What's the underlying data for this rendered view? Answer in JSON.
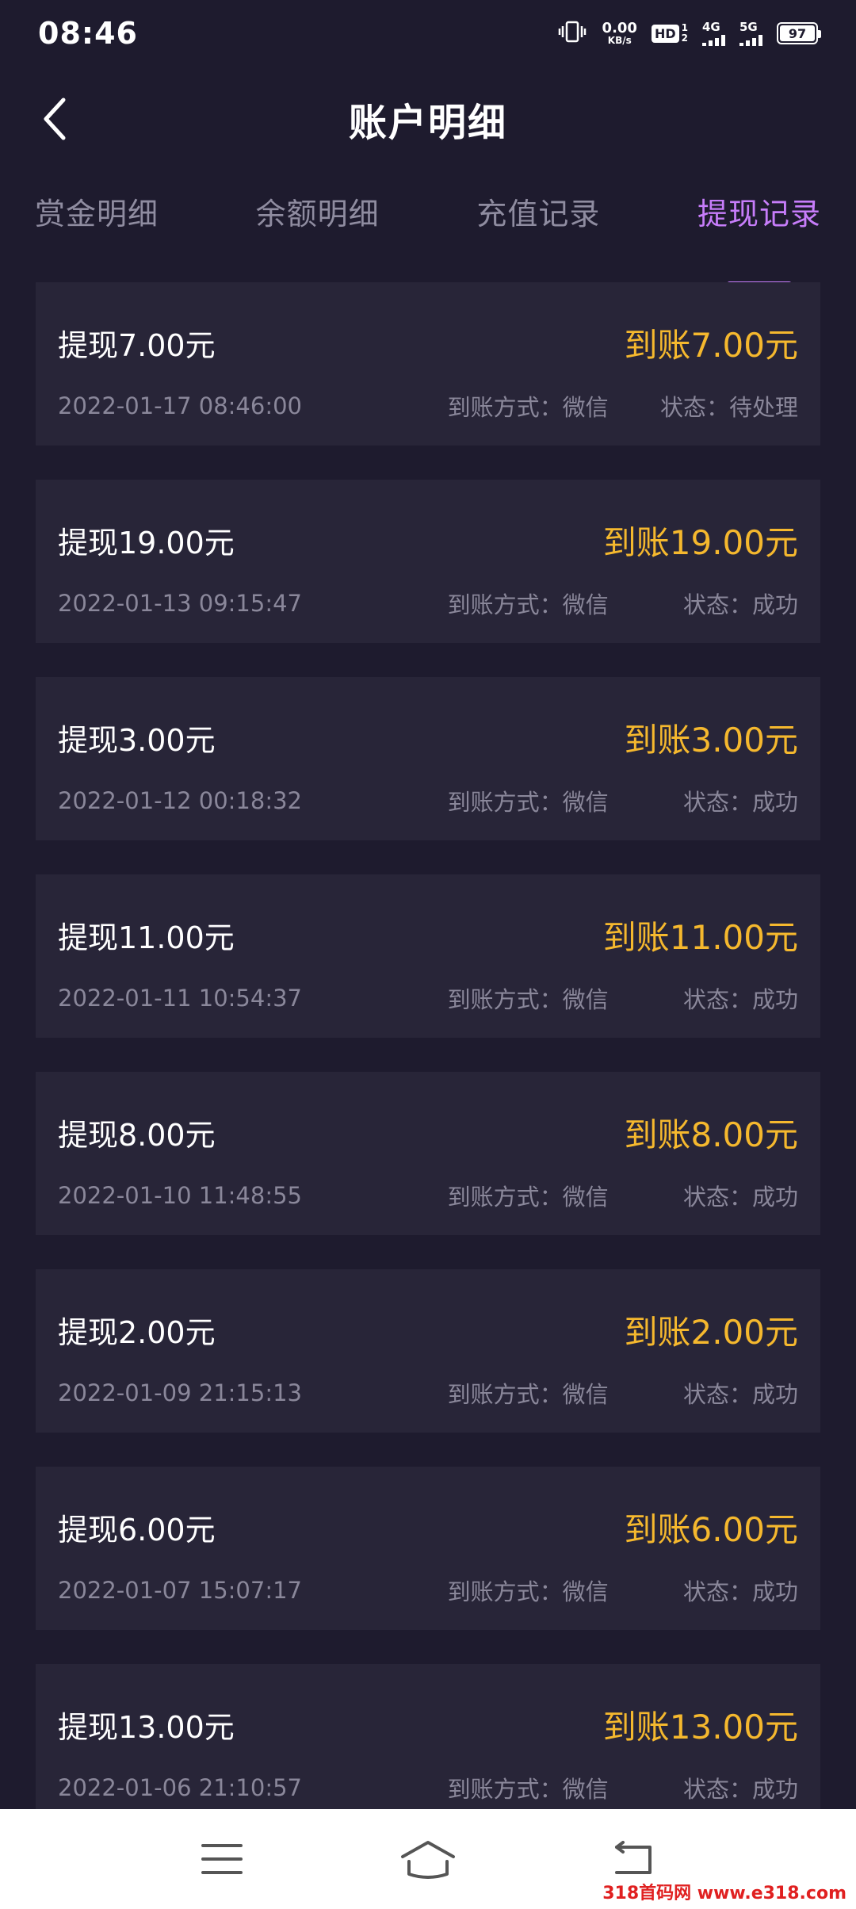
{
  "status_bar": {
    "time": "08:46",
    "net_speed": "0.00",
    "net_unit": "KB/s",
    "hd_label": "HD",
    "hd_top": "1",
    "hd_bottom": "2",
    "signal_4g": "4G",
    "signal_5g": "5G",
    "battery": "97"
  },
  "header": {
    "title": "账户明细",
    "back_icon": "chevron-left-icon"
  },
  "tabs": [
    {
      "label": "赏金明细",
      "active": false
    },
    {
      "label": "余额明细",
      "active": false
    },
    {
      "label": "充值记录",
      "active": false
    },
    {
      "label": "提现记录",
      "active": true
    }
  ],
  "records": [
    {
      "title": "提现7.00元",
      "amount": "到账7.00元",
      "time": "2022-01-17 08:46:00",
      "method": "到账方式：微信",
      "status": "状态：待处理"
    },
    {
      "title": "提现19.00元",
      "amount": "到账19.00元",
      "time": "2022-01-13 09:15:47",
      "method": "到账方式：微信",
      "status": "状态：成功"
    },
    {
      "title": "提现3.00元",
      "amount": "到账3.00元",
      "time": "2022-01-12 00:18:32",
      "method": "到账方式：微信",
      "status": "状态：成功"
    },
    {
      "title": "提现11.00元",
      "amount": "到账11.00元",
      "time": "2022-01-11 10:54:37",
      "method": "到账方式：微信",
      "status": "状态：成功"
    },
    {
      "title": "提现8.00元",
      "amount": "到账8.00元",
      "time": "2022-01-10 11:48:55",
      "method": "到账方式：微信",
      "status": "状态：成功"
    },
    {
      "title": "提现2.00元",
      "amount": "到账2.00元",
      "time": "2022-01-09 21:15:13",
      "method": "到账方式：微信",
      "status": "状态：成功"
    },
    {
      "title": "提现6.00元",
      "amount": "到账6.00元",
      "time": "2022-01-07 15:07:17",
      "method": "到账方式：微信",
      "status": "状态：成功"
    },
    {
      "title": "提现13.00元",
      "amount": "到账13.00元",
      "time": "2022-01-06 21:10:57",
      "method": "到账方式：微信",
      "status": "状态：成功"
    }
  ],
  "nav": {
    "menu_icon": "menu-icon",
    "home_icon": "home-icon",
    "back_icon": "return-icon"
  },
  "watermark": "318首码网 www.e318.com",
  "colors": {
    "background": "#1e1b2e",
    "card": "#282538",
    "accent": "#c77dfa",
    "amount": "#f5b82e",
    "muted": "#8a879a"
  }
}
